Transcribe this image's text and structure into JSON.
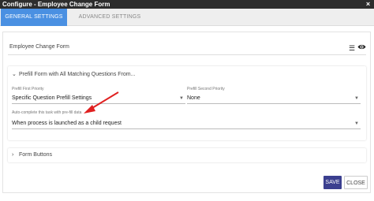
{
  "window": {
    "title": "Configure - Employee Change Form"
  },
  "tabs": [
    {
      "label": "GENERAL SETTINGS"
    },
    {
      "label": "ADVANCED SETTINGS"
    }
  ],
  "form": {
    "title": "Employee Change Form"
  },
  "section_prefill": {
    "header": "Prefill Form with All Matching Questions From...",
    "first_priority_label": "Prefill First Priority",
    "first_priority_value": "Specific Question Prefill Settings",
    "second_priority_label": "Prefill Second Priority",
    "second_priority_value": "None",
    "autocomplete_label": "Auto-complete this task with pre-fill data",
    "autocomplete_value": "When process is launched as a child request"
  },
  "section_buttons": {
    "header": "Form Buttons"
  },
  "footer": {
    "save_label": "SAVE",
    "close_label": "CLOSE"
  },
  "colors": {
    "titlebar": "#2d2d2d",
    "tab_active": "#4a90e2",
    "save_button": "#3b3f8f",
    "annotation_arrow": "#e02020"
  }
}
